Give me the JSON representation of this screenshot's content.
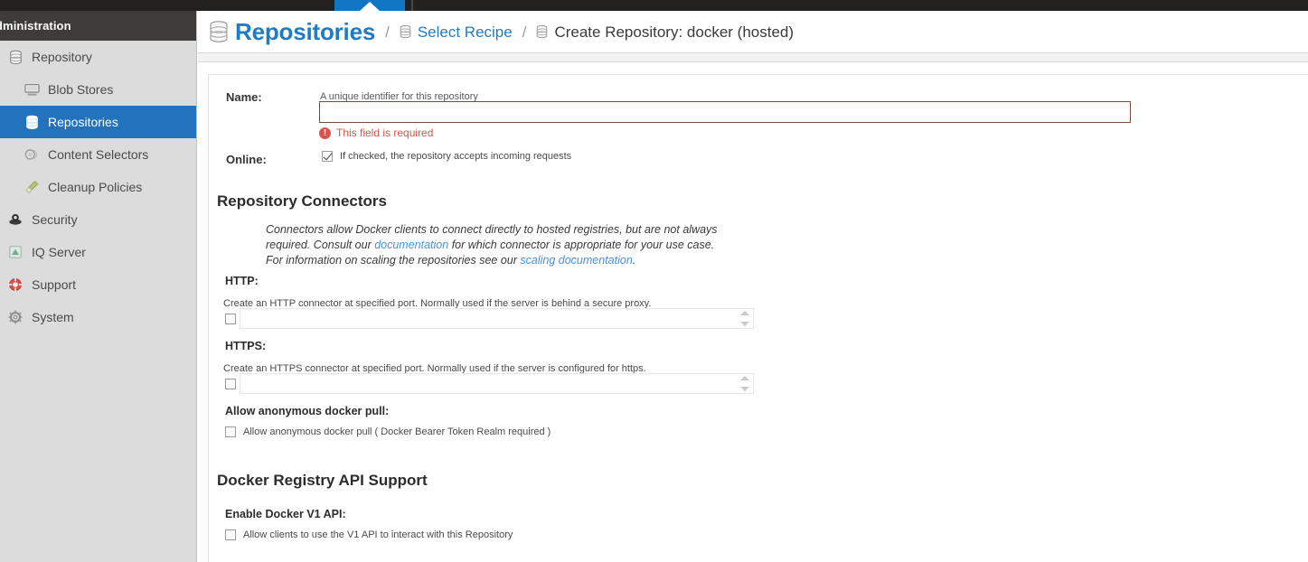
{
  "topbar": {
    "active_tab_name": "browser-tab-active"
  },
  "sidebar": {
    "header_title": "dministration",
    "items": [
      {
        "label": "Repository",
        "icon": "database-icon",
        "level": 1,
        "selected": false,
        "name": "sidebar-item-repository"
      },
      {
        "label": "Blob Stores",
        "icon": "storage-icon",
        "level": 2,
        "selected": false,
        "name": "sidebar-item-blob-stores"
      },
      {
        "label": "Repositories",
        "icon": "database-icon",
        "level": 2,
        "selected": true,
        "name": "sidebar-item-repositories"
      },
      {
        "label": "Content Selectors",
        "icon": "selector-icon",
        "level": 2,
        "selected": false,
        "name": "sidebar-item-content-selectors"
      },
      {
        "label": "Cleanup Policies",
        "icon": "broom-icon",
        "level": 2,
        "selected": false,
        "name": "sidebar-item-cleanup-policies"
      },
      {
        "label": "Security",
        "icon": "shield-icon",
        "level": 1,
        "selected": false,
        "name": "sidebar-item-security"
      },
      {
        "label": "IQ Server",
        "icon": "iq-icon",
        "level": 1,
        "selected": false,
        "name": "sidebar-item-iq-server"
      },
      {
        "label": "Support",
        "icon": "lifering-icon",
        "level": 1,
        "selected": false,
        "name": "sidebar-item-support"
      },
      {
        "label": "System",
        "icon": "gear-icon",
        "level": 1,
        "selected": false,
        "name": "sidebar-item-system"
      }
    ]
  },
  "breadcrumb": {
    "root": "Repositories",
    "separator": "/",
    "link": "Select Recipe",
    "current": "Create Repository: docker (hosted)"
  },
  "form": {
    "name_field": {
      "label": "Name:",
      "helper": "A unique identifier for this repository",
      "value": "",
      "placeholder": "",
      "error": "This field is required",
      "error_icon": "exclamation-circle-icon"
    },
    "online_field": {
      "label": "Online:",
      "checkbox_label": "If checked, the repository accepts incoming requests",
      "checked": true
    },
    "connectors": {
      "title": "Repository Connectors",
      "description_1": "Connectors allow Docker clients to connect directly to hosted registries, but are not always required. Consult our ",
      "link_1": "documentation",
      "description_2": " for which connector is appropriate for your use case. For information on scaling the repositories see our ",
      "link_2": "scaling documentation",
      "description_3": ".",
      "http": {
        "label": "HTTP:",
        "desc": "Create an HTTP connector at specified port. Normally used if the server is behind a secure proxy.",
        "checked": false,
        "value": "",
        "placeholder": ""
      },
      "https": {
        "label": "HTTPS:",
        "desc": "Create an HTTPS connector at specified port. Normally used if the server is configured for https.",
        "checked": false,
        "value": "",
        "placeholder": ""
      },
      "anonymous_pull": {
        "label": "Allow anonymous docker pull:",
        "checkbox_label": "Allow anonymous docker pull ( Docker Bearer Token Realm required )",
        "checked": false
      }
    },
    "api_support": {
      "title": "Docker Registry API Support",
      "v1": {
        "label": "Enable Docker V1 API:",
        "checkbox_label": "Allow clients to use the V1 API to interact with this Repository",
        "checked": false
      }
    }
  },
  "colors": {
    "accent_blue": "#1f7cc4",
    "selected_blue": "#2272bd",
    "error_red": "#d9534f",
    "sidebar_bg": "#dcdcdc",
    "sidebar_header_bg": "#3e3c3b",
    "topbar_bg": "#23211f"
  }
}
